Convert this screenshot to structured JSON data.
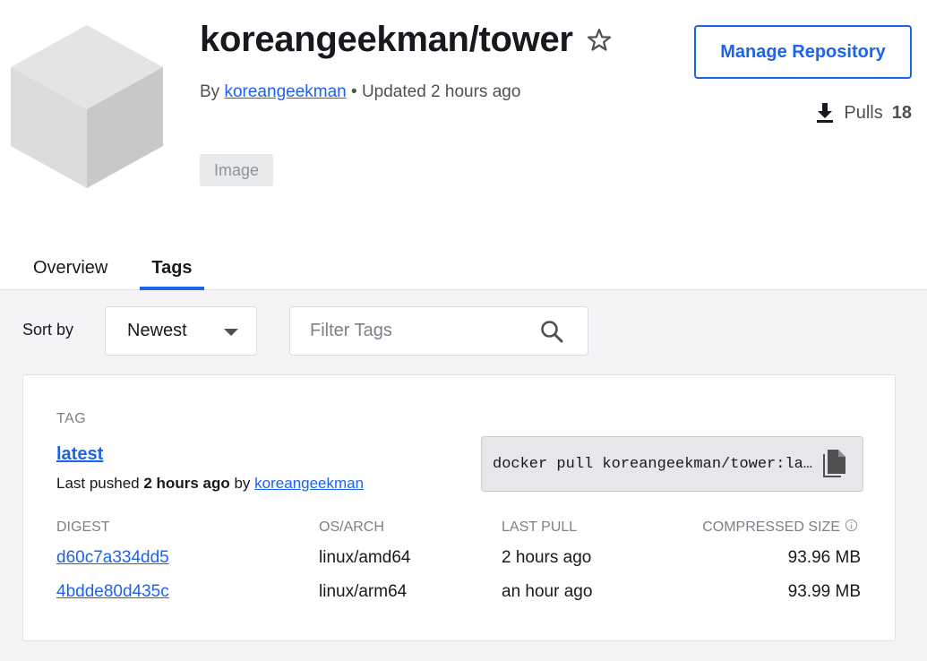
{
  "repo": {
    "title": "koreangeekman/tower",
    "by_prefix": "By",
    "owner": "koreangeekman",
    "updated": "• Updated 2 hours ago",
    "badge": "Image",
    "manage_label": "Manage Repository",
    "pulls_label": "Pulls",
    "pulls_count": "18"
  },
  "tabs": [
    {
      "label": "Overview",
      "active": false
    },
    {
      "label": "Tags",
      "active": true
    }
  ],
  "controls": {
    "sort_label": "Sort by",
    "sort_value": "Newest",
    "filter_placeholder": "Filter Tags"
  },
  "tag": {
    "section_label": "TAG",
    "name": "latest",
    "pushed_prefix": "Last pushed",
    "pushed_time": "2 hours ago",
    "pushed_by_prefix": "by",
    "pushed_by": "koreangeekman",
    "pull_command": "docker pull koreangeekman/tower:latest",
    "columns": {
      "digest": "DIGEST",
      "os_arch": "OS/ARCH",
      "last_pull": "LAST PULL",
      "size": "COMPRESSED SIZE"
    },
    "rows": [
      {
        "digest": "d60c7a334dd5",
        "os_arch": "linux/amd64",
        "last_pull": "2 hours ago",
        "size": "93.96 MB"
      },
      {
        "digest": "4bdde80d435c",
        "os_arch": "linux/arm64",
        "last_pull": "an hour ago",
        "size": "93.99 MB"
      }
    ]
  },
  "colors": {
    "accent": "#1d63ed",
    "text": "#17191e",
    "muted": "#7d8088",
    "background": "#f4f4f6"
  },
  "icons": {
    "logo": "cube-icon",
    "favorite": "star-outline-icon",
    "pulls": "download-icon",
    "search": "search-icon",
    "copy": "copy-icon",
    "info": "info-icon",
    "sort": "caret-down-icon"
  }
}
